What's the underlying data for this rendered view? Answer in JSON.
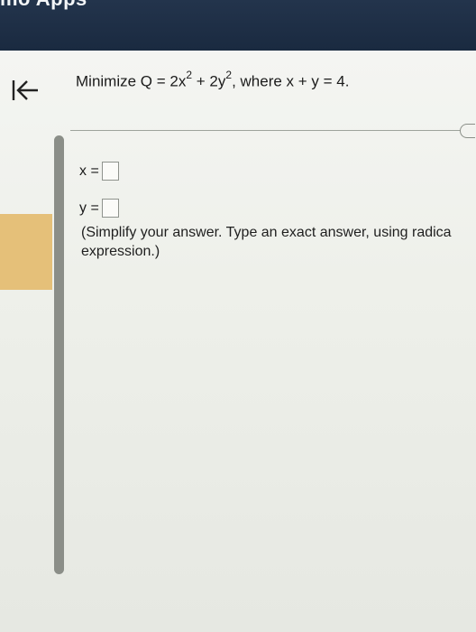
{
  "app": {
    "title": "mo Apps"
  },
  "question": {
    "prefix": "Minimize Q = 2x",
    "exp1": "2",
    "middle": " + 2y",
    "exp2": "2",
    "suffix": ", where x + y = 4."
  },
  "answers": {
    "x_label": "x =",
    "x_value": "",
    "y_label": "y =",
    "y_value": ""
  },
  "hint": {
    "text": "(Simplify your answer. Type an exact answer, using radica expression.)"
  },
  "icons": {
    "back": "back-to-start-icon",
    "handle": "panel-resize-handle-icon"
  },
  "colors": {
    "topbar": "#1a2a40",
    "highlight": "#e5c079",
    "scrollbar": "#8b8e88"
  }
}
